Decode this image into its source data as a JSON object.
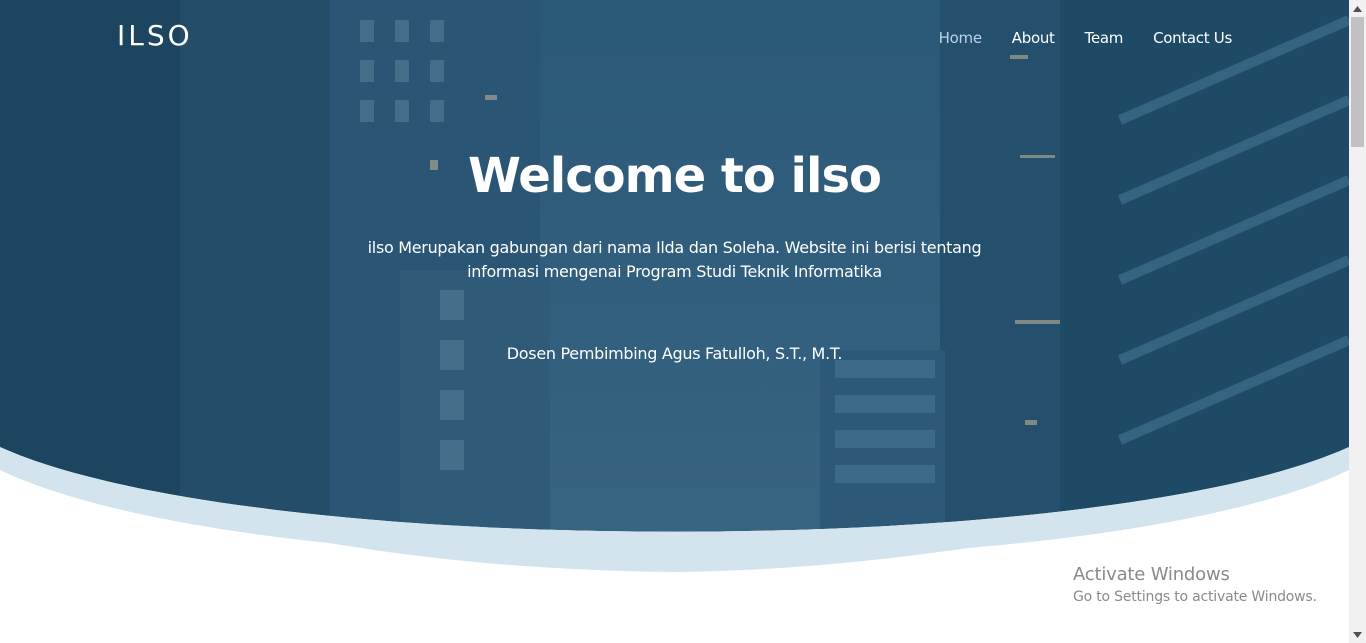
{
  "brand": {
    "name": "ILSO"
  },
  "nav": {
    "items": [
      {
        "label": "Home",
        "active": true
      },
      {
        "label": "About",
        "active": false
      },
      {
        "label": "Team",
        "active": false
      },
      {
        "label": "Contact Us",
        "active": false
      }
    ]
  },
  "hero": {
    "title": "Welcome to ilso",
    "description": "ilso Merupakan gabungan dari nama Ilda dan Soleha. Website ini berisi tentang informasi mengenai Program Studi Teknik Informatika",
    "advisor": "Dosen Pembimbing Agus Fatulloh, S.T., M.T."
  },
  "watermark": {
    "title": "Activate Windows",
    "subtitle": "Go to Settings to activate Windows."
  },
  "colors": {
    "overlay": "#1f4c6a",
    "wave_light": "#d3e4ee",
    "nav_active": "#b9d3e6",
    "text": "#ffffff"
  }
}
